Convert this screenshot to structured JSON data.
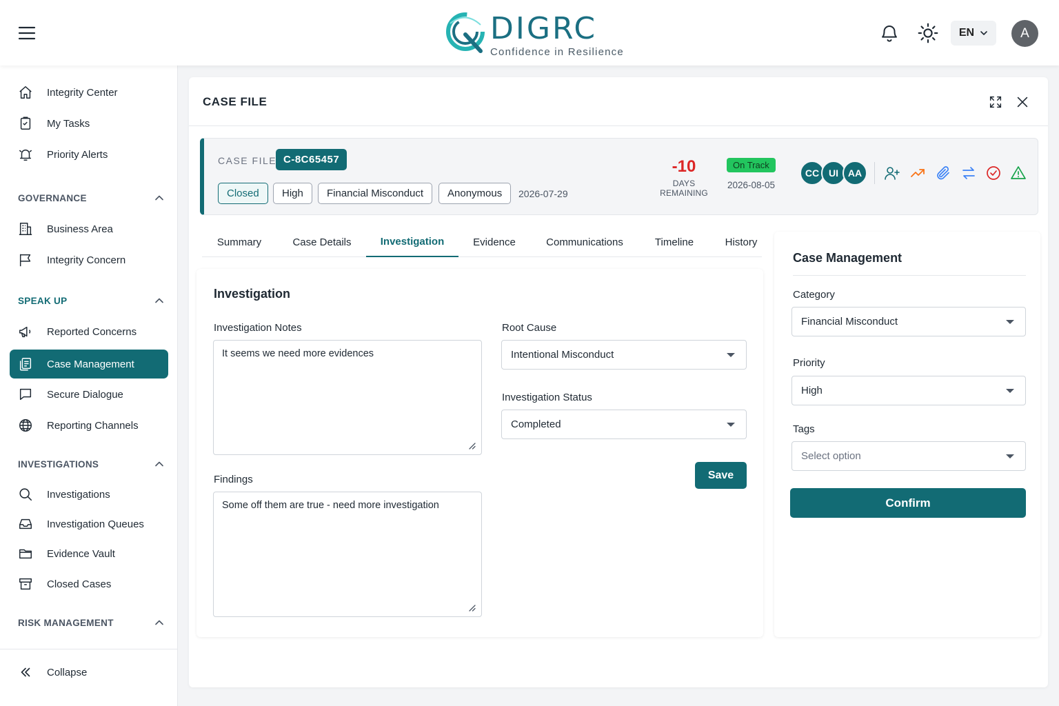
{
  "header": {
    "brand_name": "DIGRC",
    "brand_tagline": "Confidence in Resilience",
    "language": "EN",
    "user_initial": "A"
  },
  "sidebar": {
    "top_items": [
      {
        "label": "Integrity Center",
        "icon": "home-icon"
      },
      {
        "label": "My Tasks",
        "icon": "tasks-icon"
      },
      {
        "label": "Priority Alerts",
        "icon": "alarm-icon"
      }
    ],
    "sections": [
      {
        "title": "GOVERNANCE",
        "items": [
          {
            "label": "Business Area",
            "icon": "building-icon"
          },
          {
            "label": "Integrity Concern",
            "icon": "flag-icon"
          }
        ]
      },
      {
        "title": "SPEAK UP",
        "items": [
          {
            "label": "Reported Concerns",
            "icon": "megaphone-icon"
          },
          {
            "label": "Case Management",
            "icon": "case-icon",
            "active": true
          },
          {
            "label": "Secure Dialogue",
            "icon": "chat-icon"
          },
          {
            "label": "Reporting Channels",
            "icon": "globe-icon"
          }
        ]
      },
      {
        "title": "INVESTIGATIONS",
        "items": [
          {
            "label": "Investigations",
            "icon": "search-icon"
          },
          {
            "label": "Investigation Queues",
            "icon": "inbox-icon"
          },
          {
            "label": "Evidence Vault",
            "icon": "folder-icon"
          },
          {
            "label": "Closed Cases",
            "icon": "archive-icon"
          }
        ]
      },
      {
        "title": "RISK MANAGEMENT",
        "items": []
      }
    ],
    "collapse_label": "Collapse"
  },
  "panel": {
    "title": "CASE FILE",
    "case": {
      "label": "CASE FILE",
      "id": "C-8C65457",
      "chips": [
        "Closed",
        "High",
        "Financial Misconduct",
        "Anonymous"
      ],
      "created_date": "2026-07-29",
      "days_remaining": "-10",
      "days_remaining_label": "DAYS REMAINING",
      "status_badge": "On Track",
      "due_date": "2026-08-05",
      "assignees": [
        "CC",
        "UI",
        "AA"
      ],
      "actions": [
        "add-user-icon",
        "trend-up-icon",
        "paperclip-icon",
        "transfer-icon",
        "check-circle-icon",
        "warning-icon"
      ]
    },
    "tabs": [
      "Summary",
      "Case Details",
      "Investigation",
      "Evidence",
      "Communications",
      "Timeline",
      "History"
    ],
    "active_tab": "Investigation",
    "investigation": {
      "title": "Investigation",
      "notes_label": "Investigation Notes",
      "notes_value": "It seems we need more evidences",
      "findings_label": "Findings",
      "findings_value": "Some off them are true - need more investigation",
      "root_cause_label": "Root Cause",
      "root_cause_value": "Intentional Misconduct",
      "status_label": "Investigation Status",
      "status_value": "Completed",
      "save_label": "Save"
    },
    "case_management": {
      "title": "Case Management",
      "category_label": "Category",
      "category_value": "Financial Misconduct",
      "priority_label": "Priority",
      "priority_value": "High",
      "tags_label": "Tags",
      "tags_placeholder": "Select option",
      "confirm_label": "Confirm"
    }
  },
  "colors": {
    "accent": "#126b74",
    "danger": "#dc2626",
    "success": "#22c55e",
    "warning": "#f97316"
  }
}
